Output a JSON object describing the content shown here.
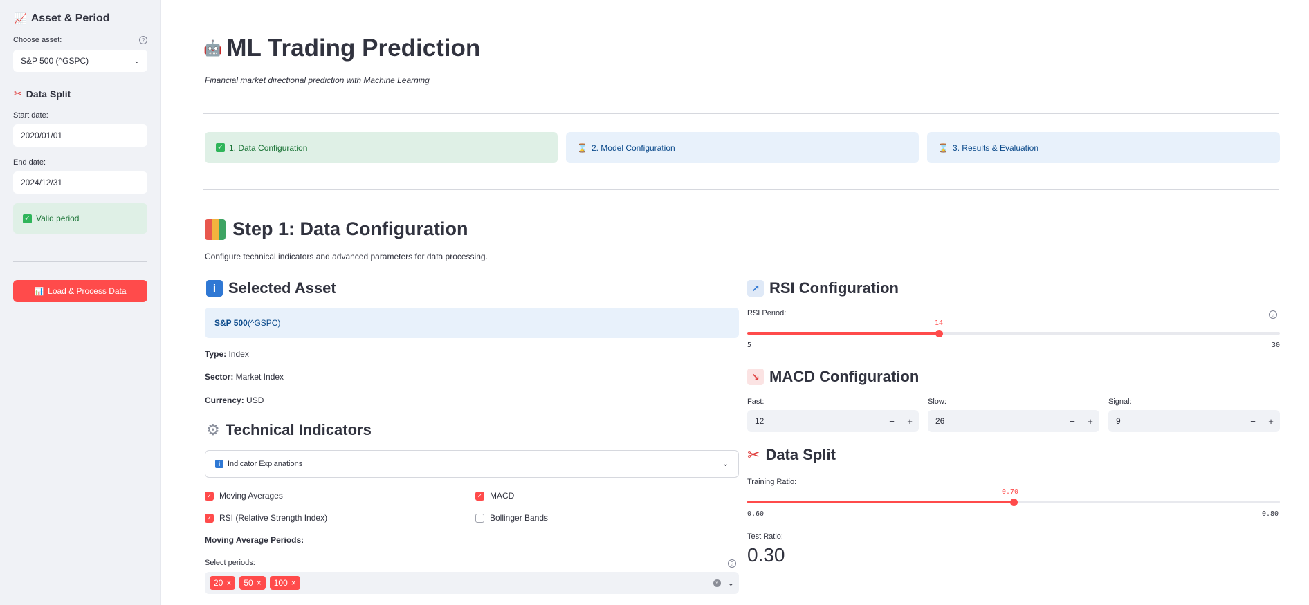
{
  "sidebar": {
    "asset_heading": "Asset & Period",
    "choose_asset_label": "Choose asset:",
    "asset_value": "S&P 500 (^GSPC)",
    "split_heading": "Data Split",
    "start_label": "Start date:",
    "start_value": "2020/01/01",
    "end_label": "End date:",
    "end_value": "2024/12/31",
    "valid_msg": "Valid period",
    "load_button": "Load & Process Data"
  },
  "header": {
    "title": "ML Trading Prediction",
    "subtitle": "Financial market directional prediction with Machine Learning"
  },
  "steps": [
    {
      "label": "1. Data Configuration",
      "icon": "check-icon",
      "state": "done"
    },
    {
      "label": "2. Model Configuration",
      "icon": "hourglass-icon",
      "state": "pending"
    },
    {
      "label": "3. Results & Evaluation",
      "icon": "hourglass-icon",
      "state": "pending"
    }
  ],
  "step1": {
    "title": "Step 1: Data Configuration",
    "description": "Configure technical indicators and advanced parameters for data processing."
  },
  "selected_asset": {
    "heading": "Selected Asset",
    "name": "S&P 500",
    "ticker": " (^GSPC)",
    "type_label": "Type:",
    "type_value": " Index",
    "sector_label": "Sector:",
    "sector_value": " Market Index",
    "currency_label": "Currency:",
    "currency_value": " USD"
  },
  "indicators": {
    "heading": "Technical Indicators",
    "expander": "Indicator Explanations",
    "items": [
      {
        "label": "Moving Averages",
        "checked": true
      },
      {
        "label": "MACD",
        "checked": true
      },
      {
        "label": "RSI (Relative Strength Index)",
        "checked": true
      },
      {
        "label": "Bollinger Bands",
        "checked": false
      }
    ],
    "ma_heading": "Moving Average Periods:",
    "select_label": "Select periods:",
    "periods": [
      "20",
      "50",
      "100"
    ]
  },
  "rsi": {
    "heading": "RSI Configuration",
    "label": "RSI Period:",
    "value": "14",
    "min": "5",
    "max": "30",
    "fraction": 0.36
  },
  "macd": {
    "heading": "MACD Configuration",
    "fast_label": "Fast:",
    "fast_value": "12",
    "slow_label": "Slow:",
    "slow_value": "26",
    "signal_label": "Signal:",
    "signal_value": "9"
  },
  "split": {
    "heading": "Data Split",
    "train_label": "Training Ratio:",
    "train_value": "0.70",
    "min": "0.60",
    "max": "0.80",
    "fraction": 0.5,
    "test_label": "Test Ratio:",
    "test_value": "0.30"
  },
  "colors": {
    "accent": "#ff4b4b",
    "success_bg": "#dff0e6",
    "info_bg": "#e8f1fb"
  }
}
